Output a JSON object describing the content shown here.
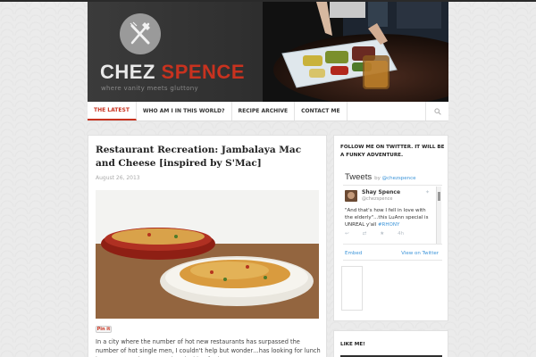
{
  "header": {
    "logo_word1": "CHEZ",
    "logo_word2": "SPENCE",
    "tagline": "where vanity meets gluttony",
    "accent_color": "#c8321f"
  },
  "nav": {
    "items": [
      {
        "label": "THE LATEST",
        "active": true
      },
      {
        "label": "WHO AM I IN THIS WORLD?",
        "active": false
      },
      {
        "label": "RECIPE ARCHIVE",
        "active": false
      },
      {
        "label": "CONTACT ME",
        "active": false
      }
    ],
    "search_icon": "search-icon"
  },
  "post": {
    "title": "Restaurant Recreation: Jambalaya Mac and Cheese [inspired by S'Mac]",
    "date": "August 26, 2013",
    "pin_label": "Pin it",
    "excerpt": "In a city where the number of hot new restaurants has surpassed the number of hot single men, I couldn't help but wonder…has looking for lunch become more important than looking for love?"
  },
  "sidebar": {
    "twitter_title": "FOLLOW ME ON TWITTER. IT WILL BE A FUNKY ADVENTURE.",
    "tweets_label": "Tweets",
    "by_label": "by",
    "by_handle": "@chezspence",
    "tweet": {
      "name": "Shay Spence",
      "handle": "@chezspence",
      "text": "\"And that's how I fell in love with the elderly\"...this LuAnn special is UNREAL y'all ",
      "hashtag": "#RHONY",
      "time": "4h"
    },
    "embed_label": "Embed",
    "view_label": "View on Twitter",
    "like_title": "LIKE ME!"
  }
}
